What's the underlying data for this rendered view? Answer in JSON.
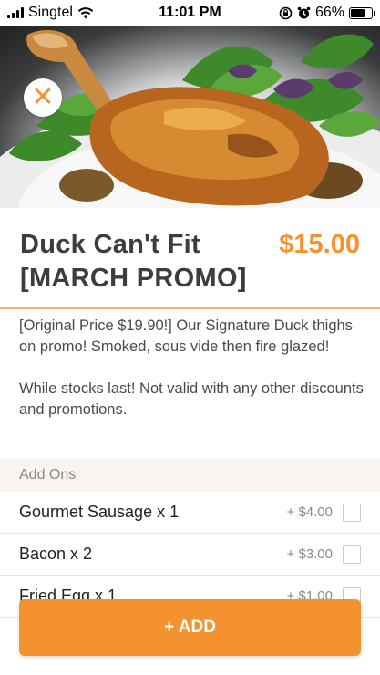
{
  "status_bar": {
    "carrier": "Singtel",
    "time": "11:01 PM",
    "battery": "66%",
    "battery_level": 0.66
  },
  "hero": {
    "image": "roast-duck-thigh-photo",
    "close_icon": "close-icon"
  },
  "item": {
    "name": "Duck Can't Fit [MARCH PROMO]",
    "price": "$15.00",
    "description_lines": [
      "[Original Price $19.90!] Our Signature Duck thighs on promo! Smoked, sous vide then fire glazed!",
      "While stocks last! Not valid with any other discounts and promotions."
    ]
  },
  "addons": {
    "header": "Add Ons",
    "items": [
      {
        "name": "Gourmet Sausage x 1",
        "price": "+ $4.00",
        "checked": false
      },
      {
        "name": "Bacon x 2",
        "price": "+ $3.00",
        "checked": false
      },
      {
        "name": "Fried Egg x 1",
        "price": "+ $1.00",
        "checked": false
      },
      {
        "name": "",
        "price": "",
        "checked": false
      }
    ]
  },
  "add_button": {
    "label": "+ ADD"
  },
  "colors": {
    "accent": "#f3922f",
    "accent_border": "#f2b56b",
    "addons_bg": "#f8f4ef"
  }
}
